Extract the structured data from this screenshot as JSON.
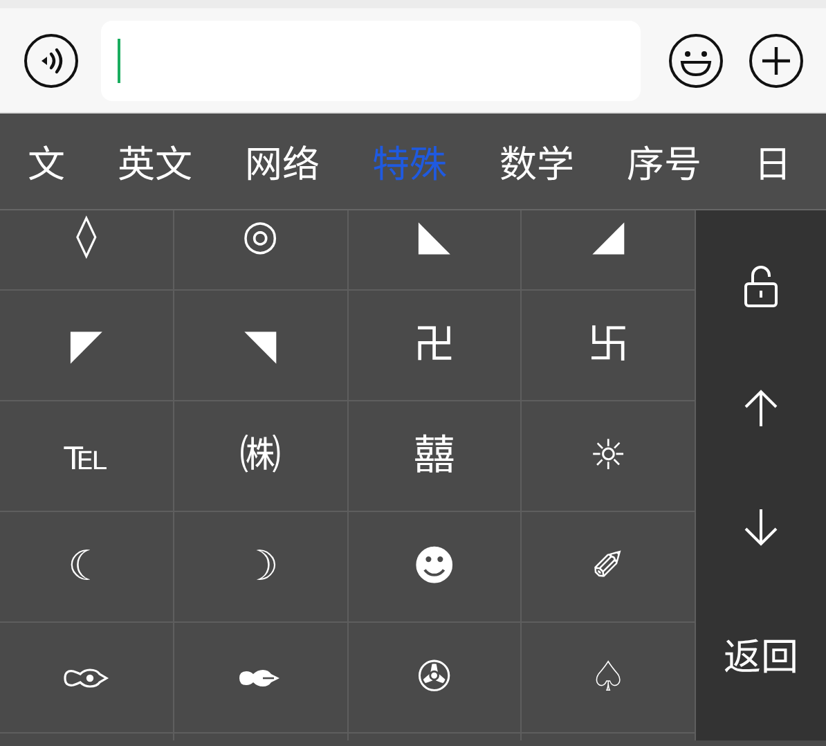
{
  "tabs": [
    {
      "label": "文",
      "selected": false
    },
    {
      "label": "英文",
      "selected": false
    },
    {
      "label": "网络",
      "selected": false
    },
    {
      "label": "特殊",
      "selected": true
    },
    {
      "label": "数学",
      "selected": false
    },
    {
      "label": "序号",
      "selected": false
    },
    {
      "label": "日",
      "selected": false
    }
  ],
  "keys": [
    {
      "kind": "text",
      "symbol": "◊"
    },
    {
      "kind": "text",
      "symbol": "◎"
    },
    {
      "kind": "text",
      "symbol": "◣"
    },
    {
      "kind": "text",
      "symbol": "◢"
    },
    {
      "kind": "text",
      "symbol": "◤"
    },
    {
      "kind": "text",
      "symbol": "◥"
    },
    {
      "kind": "text",
      "symbol": "卍"
    },
    {
      "kind": "text",
      "symbol": "卐"
    },
    {
      "kind": "text",
      "symbol": "℡"
    },
    {
      "kind": "text",
      "symbol": "㈱"
    },
    {
      "kind": "text",
      "symbol": "囍"
    },
    {
      "kind": "text",
      "symbol": "☼"
    },
    {
      "kind": "text",
      "symbol": "☾"
    },
    {
      "kind": "text",
      "symbol": "☽"
    },
    {
      "kind": "text",
      "symbol": "☻"
    },
    {
      "kind": "text",
      "symbol": "✐"
    },
    {
      "kind": "gourd-outline"
    },
    {
      "kind": "gourd-solid"
    },
    {
      "kind": "text",
      "symbol": "✇"
    },
    {
      "kind": "text",
      "symbol": "♤"
    }
  ],
  "side_panel": {
    "back_label": "返回"
  }
}
